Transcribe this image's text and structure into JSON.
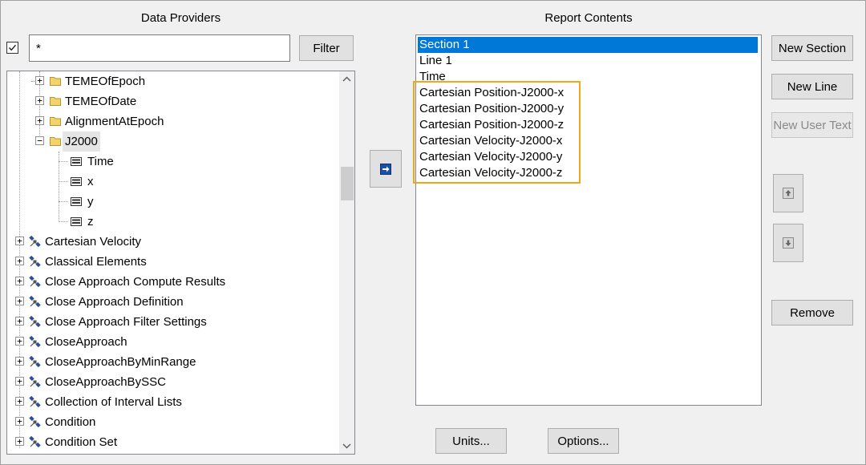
{
  "left_panel": {
    "title": "Data Providers",
    "filter_checkbox_checked": true,
    "filter_value": "*",
    "filter_button": "Filter",
    "tree_items": [
      {
        "label": "TEMEOfEpoch",
        "icon": "folder-icon",
        "state": "+"
      },
      {
        "label": "TEMEOfDate",
        "icon": "folder-icon",
        "state": "+"
      },
      {
        "label": "AlignmentAtEpoch",
        "icon": "folder-icon",
        "state": "+"
      },
      {
        "label": "J2000",
        "icon": "folder-icon",
        "state": "−"
      },
      {
        "label": "Time",
        "icon": "data-element-icon"
      },
      {
        "label": "x",
        "icon": "data-element-icon"
      },
      {
        "label": "y",
        "icon": "data-element-icon"
      },
      {
        "label": "z",
        "icon": "data-element-icon"
      },
      {
        "label": "Cartesian Velocity",
        "icon": "satellite-icon",
        "state": "+"
      },
      {
        "label": "Classical Elements",
        "icon": "satellite-icon",
        "state": "+"
      },
      {
        "label": "Close Approach Compute Results",
        "icon": "satellite-icon",
        "state": "+"
      },
      {
        "label": "Close Approach Definition",
        "icon": "satellite-icon",
        "state": "+"
      },
      {
        "label": "Close Approach Filter Settings",
        "icon": "satellite-icon",
        "state": "+"
      },
      {
        "label": "CloseApproach",
        "icon": "satellite-icon",
        "state": "+"
      },
      {
        "label": "CloseApproachByMinRange",
        "icon": "satellite-icon",
        "state": "+"
      },
      {
        "label": "CloseApproachBySSC",
        "icon": "satellite-icon",
        "state": "+"
      },
      {
        "label": "Collection of Interval Lists",
        "icon": "satellite-icon",
        "state": "+"
      },
      {
        "label": "Condition",
        "icon": "satellite-icon",
        "state": "+"
      },
      {
        "label": "Condition Set",
        "icon": "satellite-icon",
        "state": "+"
      }
    ]
  },
  "right_panel": {
    "title": "Report Contents",
    "items": [
      "Section 1",
      "Line 1",
      "Time",
      "Cartesian Position-J2000-x",
      "Cartesian Position-J2000-y",
      "Cartesian Position-J2000-z",
      "Cartesian Velocity-J2000-x",
      "Cartesian Velocity-J2000-y",
      "Cartesian Velocity-J2000-z"
    ],
    "selected_index": 0
  },
  "buttons": {
    "new_section": "New Section",
    "new_line": "New Line",
    "new_user_text": "New User Text",
    "remove": "Remove",
    "units": "Units...",
    "options": "Options..."
  },
  "icons": {
    "add_arrow": "arrow-right-icon",
    "move_up": "move-up-icon",
    "move_down": "move-down-icon"
  },
  "colors": {
    "selection": "#0078d7",
    "highlight_box": "#f0a818",
    "folder": "#f3d36b"
  }
}
